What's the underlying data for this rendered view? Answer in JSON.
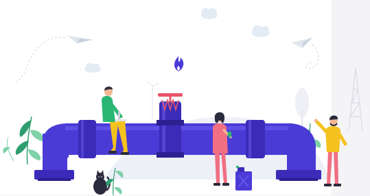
{
  "scene": {
    "subject": "pipeline-illustration",
    "colors": {
      "pipe_main": "#4b3bd6",
      "pipe_dark": "#3a2cb8",
      "pipe_light": "#6b5cf0",
      "valve_handle": "#e8556a",
      "flame": "#4b3bd6",
      "hill": "#eceef8",
      "cloud": "#e3ecf4",
      "leaf_green": "#2f9e6e",
      "leaf_light": "#7fd1a8",
      "person_yellow": "#f4c21f",
      "person_green": "#2bb673",
      "person_pink": "#f06f82",
      "canister": "#4b3bd6",
      "side_panel": "#f4f4f6"
    }
  }
}
